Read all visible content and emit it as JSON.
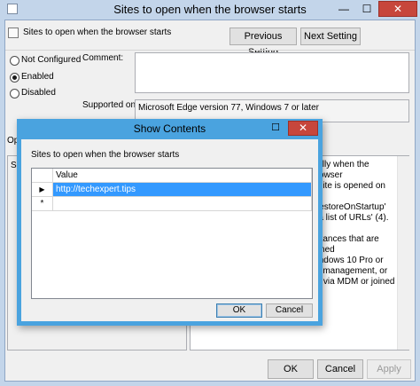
{
  "outer": {
    "title": "Sites to open when the browser starts",
    "controls": {
      "minimize": "—",
      "maximize": "☐",
      "close": "✕"
    },
    "setting_name": "Sites to open when the browser starts",
    "previous_setting": "Previous Setting",
    "next_setting": "Next Setting",
    "options": [
      "Not Configured",
      "Enabled",
      "Disabled"
    ],
    "selected_option": "Enabled",
    "comment_label": "Comment:",
    "supported_label": "Supported on:",
    "supported_value": "Microsoft Edge version 77, Windows 7 or later",
    "options_label_partial": "Op",
    "help_label_partial": "Sit",
    "help_text": [
      "ically when the browser",
      "o site is opened on",
      "",
      "'RestoreOnStartup'",
      "n a list of URLs' (4).",
      "",
      "nstances that are joined",
      "Vindows 10 Pro or",
      "ce management, or",
      "ed via MDM or joined"
    ],
    "ok": "OK",
    "cancel": "Cancel",
    "apply": "Apply"
  },
  "dialog": {
    "title": "Show Contents",
    "controls": {
      "close": "✕",
      "maximize": "☐"
    },
    "label": "Sites to open when the browser starts",
    "column_header": "Value",
    "rows": [
      {
        "marker": "▶",
        "value": "http://techexpert.tips"
      },
      {
        "marker": "*",
        "value": ""
      }
    ],
    "ok": "OK",
    "cancel": "Cancel"
  },
  "colors": {
    "outer_frame": "#c3d5ea",
    "dialog_frame": "#4aa3df",
    "selection": "#3399ff",
    "close_button": "#c7463c"
  }
}
